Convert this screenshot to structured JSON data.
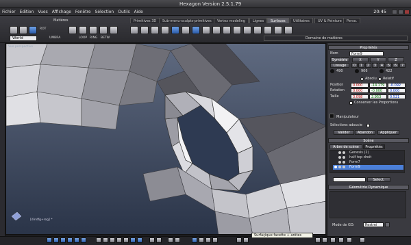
{
  "window": {
    "title": "Hexagon Version 2.5.1.79",
    "clock": "20:45"
  },
  "menu": [
    "Fichier",
    "Edition",
    "Vues",
    "Affichage",
    "Fenêtre",
    "Sélection",
    "Outils",
    "Aide"
  ],
  "toolbar": {
    "materials_label": "Matières",
    "world_value": "World",
    "domain_label": "Domaine de matières",
    "small_labels": {
      "rot": "ROT",
      "umbra": "UMBRA",
      "loop": "LOOP",
      "ring": "RING",
      "betw": "BETW"
    },
    "tabs": [
      {
        "label": "Primitives 3D",
        "active": false
      },
      {
        "label": "Sub-menu-sculpts-primitives",
        "active": false
      },
      {
        "label": "Vertex modeling",
        "active": false
      },
      {
        "label": "Lignes",
        "active": false
      },
      {
        "label": "Surfaces",
        "active": true
      },
      {
        "label": "Utilitaires",
        "active": false
      },
      {
        "label": "UV & Peinture",
        "active": false
      },
      {
        "label": "Perso.",
        "active": false
      }
    ]
  },
  "viewport": {
    "label": "Vue perspective",
    "coord_text": "[dindfg+rog] *"
  },
  "properties": {
    "header": "Propriétés",
    "nom_label": "Nom",
    "nom_value": "Form9",
    "symetrie_label": "Symétrie",
    "sym_axes": [
      "X",
      "Y",
      "Z"
    ],
    "lissage_label": "Lissage",
    "lissage_levels": [
      "0",
      "1",
      "2",
      "3",
      "4",
      "5",
      "6",
      "7"
    ],
    "counts": [
      "490",
      "906",
      "422"
    ],
    "absolu_label": "Absolu",
    "relatif_label": "Relatif",
    "position_label": "Position",
    "position": [
      "0.000",
      "-14.179",
      "-0.092"
    ],
    "rotation_label": "Rotation",
    "rotation": [
      "0.000",
      "-0.000",
      "0.000"
    ],
    "taille_label": "Taille",
    "taille": [
      "3.098",
      "2.953",
      "0.521"
    ],
    "conserver_label": "Conserver les Proportions",
    "manipulateur_label": "Manipulateur",
    "selections_label": "Sélections adoucie",
    "buttons": {
      "valider": "Valider",
      "abandon": "Abandon",
      "appliquer": "Appliquer"
    }
  },
  "scene": {
    "header": "Scène",
    "tab_tree": "Arbre de scène",
    "tab_props": "Propriétés",
    "items": [
      "Genesis (2)",
      "half top droit",
      "Form7",
      "Form9"
    ],
    "selected_index": 3,
    "select_label": "Select."
  },
  "geometry": {
    "header": "Géométrie Dynamique",
    "mode_label": "Mode de GD:",
    "mode_value": "Restrei"
  },
  "status": {
    "tooltip": "Surfaçique facette + arêtes"
  },
  "colors": {
    "selection": "#4b7fd8",
    "viewport_bg": "#2e3a52",
    "panel_bg": "#3a3a40"
  }
}
